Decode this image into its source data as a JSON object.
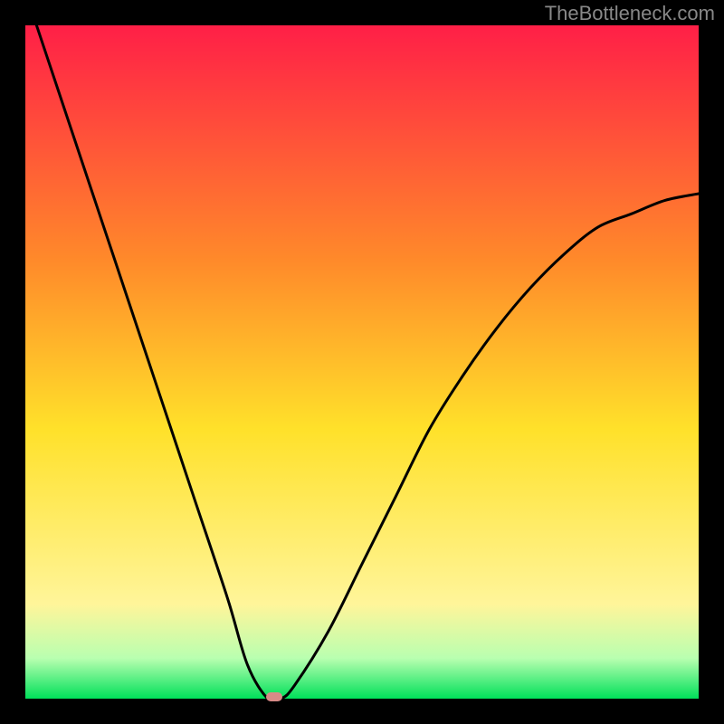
{
  "watermark": "TheBottleneck.com",
  "colors": {
    "background": "#000000",
    "gradient_top": "#ff1f47",
    "gradient_mid_upper": "#ff8a2a",
    "gradient_mid": "#ffe12a",
    "gradient_mid_lower": "#fff59a",
    "gradient_low": "#b9ffb0",
    "gradient_bottom": "#00e05a",
    "curve": "#000000",
    "marker": "#d88a87",
    "watermark_text": "#888888"
  },
  "chart_data": {
    "type": "line",
    "title": "",
    "xlabel": "",
    "ylabel": "",
    "x": [
      0.0,
      0.05,
      0.1,
      0.15,
      0.2,
      0.25,
      0.3,
      0.33,
      0.36,
      0.38,
      0.4,
      0.45,
      0.5,
      0.55,
      0.6,
      0.65,
      0.7,
      0.75,
      0.8,
      0.85,
      0.9,
      0.95,
      1.0
    ],
    "values": [
      1.05,
      0.9,
      0.75,
      0.6,
      0.45,
      0.3,
      0.15,
      0.05,
      0.0,
      0.0,
      0.02,
      0.1,
      0.2,
      0.3,
      0.4,
      0.48,
      0.55,
      0.61,
      0.66,
      0.7,
      0.72,
      0.74,
      0.75
    ],
    "xlim": [
      0,
      1
    ],
    "ylim": [
      0,
      1
    ],
    "marker_point": {
      "x": 0.37,
      "y": 0.0
    }
  }
}
